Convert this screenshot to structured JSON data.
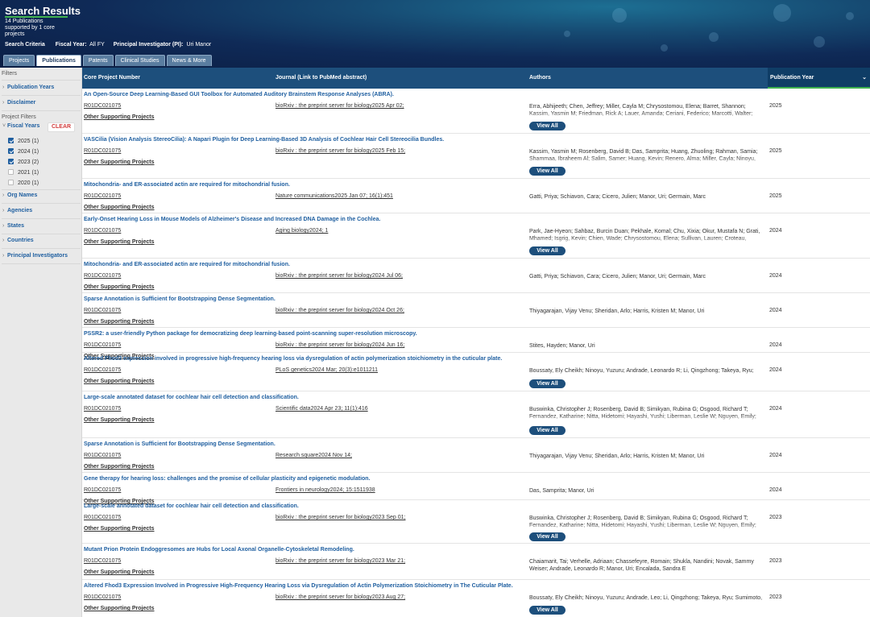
{
  "header": {
    "title": "Search Results",
    "subtitle": "14 Publications supported by 1 core projects",
    "criteria_label": "Search Criteria",
    "fiscal_year_label": "Fiscal Year:",
    "fiscal_year_value": "All FY",
    "pi_label": "Principal Investigator (PI):",
    "pi_value": "Uri Manor"
  },
  "tabs": [
    {
      "label": "Projects",
      "active": false
    },
    {
      "label": "Publications",
      "active": true
    },
    {
      "label": "Patents",
      "active": false
    },
    {
      "label": "Clinical Studies",
      "active": false
    },
    {
      "label": "News & More",
      "active": false
    }
  ],
  "sidebar": {
    "filters_label": "Filters",
    "publication_years": "Publication Years",
    "disclaimer": "Disclaimer",
    "project_filters_label": "Project Filters",
    "fiscal_years": "Fiscal Years",
    "clear_label": "CLEAR",
    "fiscal_year_options": [
      {
        "label": "2025 (1)",
        "checked": true
      },
      {
        "label": "2024 (1)",
        "checked": true
      },
      {
        "label": "2023 (2)",
        "checked": true
      },
      {
        "label": "2021 (1)",
        "checked": false
      },
      {
        "label": "2020 (1)",
        "checked": false
      }
    ],
    "other_filters": [
      "Org Names",
      "Agencies",
      "States",
      "Countries",
      "Principal Investigators"
    ]
  },
  "table": {
    "columns": {
      "project": "Core Project Number",
      "journal": "Journal (Link to PubMed abstract)",
      "authors": "Authors",
      "year": "Publication Year"
    },
    "other_label": "Other Supporting Projects",
    "view_all_label": "View All",
    "rows": [
      {
        "title": "An Open-Source Deep Learning-Based GUI Toolbox for Automated Auditory Brainstem Response Analyses (ABRA).",
        "project": "R01DC021075",
        "journal": "bioRxiv : the preprint server for biology2025 Apr 02;",
        "authors": "Erra, Abhijeeth; Chen, Jeffrey; Miller, Cayla M; Chrysostomou, Elena; Barret, Shannon; Kassim, Yasmin M; Friedman, Rick A; Lauer, Amanda; Ceriani, Federico; Marcotti, Walter; Carroll, Cody; Manor, Uri",
        "year": "2025",
        "view_all": true
      },
      {
        "title": "VASCilia (Vision Analysis StereoCilia): A Napari Plugin for Deep Learning-Based 3D Analysis of Cochlear Hair Cell Stereocilia Bundles.",
        "project": "R01DC021075",
        "journal": "bioRxiv : the preprint server for biology2025 Feb 15;",
        "authors": "Kassim, Yasmin M; Rosenberg, David B; Das, Samprita; Huang, Zhuoling; Rahman, Samia; Shammaa, Ibraheem Al; Salim, Samer; Huang, Kevin; Renero, Alma; Miller, Cayla; Ninoyu, Yuzuru; Friedman, Rick A; Indzhykulian, Artur; Manor, Uri",
        "year": "2025",
        "view_all": true
      },
      {
        "title": "Mitochondria- and ER-associated actin are required for mitochondrial fusion.",
        "project": "R01DC021075",
        "journal": "Nature communications2025 Jan 07; 16(1):451",
        "authors": "Gatti, Priya; Schiavon, Cara; Cicero, Julien; Manor, Uri; Germain, Marc",
        "year": "2025",
        "view_all": false
      },
      {
        "title": "Early-Onset Hearing Loss in Mouse Models of Alzheimer's Disease and Increased DNA Damage in the Cochlea.",
        "project": "R01DC021075",
        "journal": "Aging biology2024; 1",
        "authors": "Park, Jae-Hyeon; Sahbaz, Burcin Duan; Pekhale, Komal; Chu, Xixia; Okur, Mustafa N; Grati, Mhamed; Isgrig, Kevin; Chien, Wade; Chrysostomou, Elena; Sullivan, Lauren; Croteau, Deborah L; Manor, Uri; Bohr, Vilhelm A",
        "year": "2024",
        "view_all": true
      },
      {
        "title": "Mitochondria- and ER-associated actin are required for mitochondrial fusion.",
        "project": "R01DC021075",
        "journal": "bioRxiv : the preprint server for biology2024 Jul 06;",
        "authors": "Gatti, Priya; Schiavon, Cara; Cicero, Julien; Manor, Uri; Germain, Marc",
        "year": "2024",
        "view_all": false
      },
      {
        "title": "Sparse Annotation is Sufficient for Bootstrapping Dense Segmentation.",
        "project": "R01DC021075",
        "journal": "bioRxiv : the preprint server for biology2024 Oct 26;",
        "authors": "Thiyagarajan, Vijay Venu; Sheridan, Arlo; Harris, Kristen M; Manor, Uri",
        "year": "2024",
        "view_all": false
      },
      {
        "title": "PSSR2: a user-friendly Python package for democratizing deep learning-based point-scanning super-resolution microscopy.",
        "project": "R01DC021075",
        "journal": "bioRxiv : the preprint server for biology2024 Jun 16;",
        "authors": "Stites, Hayden; Manor, Uri",
        "year": "2024",
        "view_all": false
      },
      {
        "title": "Altered Fhod3 expression involved in progressive high-frequency hearing loss via dysregulation of actin polymerization stoichiometry in the cuticular plate.",
        "project": "R01DC021075",
        "journal": "PLoS genetics2024 Mar; 20(3):e1011211",
        "authors": "Boussaty, Ely Cheikh; Ninoyu, Yuzuru; Andrade, Leonardo R; Li, Qingzhong; Takeya, Ryu; Sumimoto, Hideki; Ohyama, Takahiro; Wahlin, Karl J; Manor, Uri; Friedman, Rick A",
        "year": "2024",
        "view_all": true
      },
      {
        "title": "Large-scale annotated dataset for cochlear hair cell detection and classification.",
        "project": "R01DC021075",
        "journal": "Scientific data2024 Apr 23; 11(1):416",
        "authors": "Buswinka, Christopher J; Rosenberg, David B; Simikyan, Rubina G; Osgood, Richard T; Fernandez, Katharine; Nitta, Hidetomi; Hayashi, Yushi; Liberman, Leslie W; Nguyen, Emily; Yildiz, Erdem; Kim, Jinkyung; Jarysta, Amandine; Renauld, Justine; Wesson, Ella;",
        "year": "2024",
        "view_all": true
      },
      {
        "title": "Sparse Annotation is Sufficient for Bootstrapping Dense Segmentation.",
        "project": "R01DC021075",
        "journal": "Research square2024 Nov 14;",
        "authors": "Thiyagarajan, Vijay Venu; Sheridan, Arlo; Harris, Kristen M; Manor, Uri",
        "year": "2024",
        "view_all": false
      },
      {
        "title": "Gene therapy for hearing loss: challenges and the promise of cellular plasticity and epigenetic modulation.",
        "project": "R01DC021075",
        "journal": "Frontiers in neurology2024; 15:1511938",
        "authors": "Das, Samprita; Manor, Uri",
        "year": "2024",
        "view_all": false
      },
      {
        "title": "Large-scale annotated dataset for cochlear hair cell detection and classification.",
        "project": "R01DC021075",
        "journal": "bioRxiv : the preprint server for biology2023 Sep 01;",
        "authors": "Buswinka, Christopher J; Rosenberg, David B; Simikyan, Rubina G; Osgood, Richard T; Fernandez, Katharine; Nitta, Hidetomi; Hayashi, Yushi; Liberman, Leslie W; Nguyen, Emily; Yildiz, Erdem; Kim, Jinkyung; Jarysta, Amandine; Renauld, Justine; Wesson, Ella;",
        "year": "2023",
        "view_all": true
      },
      {
        "title": "Mutant Prion Protein Endoggresomes are Hubs for Local Axonal Organelle-Cytoskeletal Remodeling.",
        "project": "R01DC021075",
        "journal": "bioRxiv : the preprint server for biology2023 Mar 21;",
        "authors": "Chaiamarit, Tai; Verhelle, Adriaan; Chassefeyre, Romain; Shukla, Nandini; Novak, Sammy Weiser; Andrade, Leonardo R; Manor, Uri; Encalada, Sandra E",
        "year": "2023",
        "view_all": false
      },
      {
        "title": "Altered Fhod3 Expression Involved in Progressive High-Frequency Hearing Loss via Dysregulation of Actin Polymerization Stoichiometry in The Cuticular Plate.",
        "project": "R01DC021075",
        "journal": "bioRxiv : the preprint server for biology2023 Aug 27;",
        "authors": "Boussaty, Ely Cheikh; Ninoyu, Yuzuru; Andrade, Leo; Li, Qingzhong; Takeya, Ryu; Sumimoto, Hideki; Ohyama, Takahiro; Wahlin, Karl J; Manor, Uri; Friedman, Rick A",
        "year": "2023",
        "view_all": true
      }
    ]
  }
}
